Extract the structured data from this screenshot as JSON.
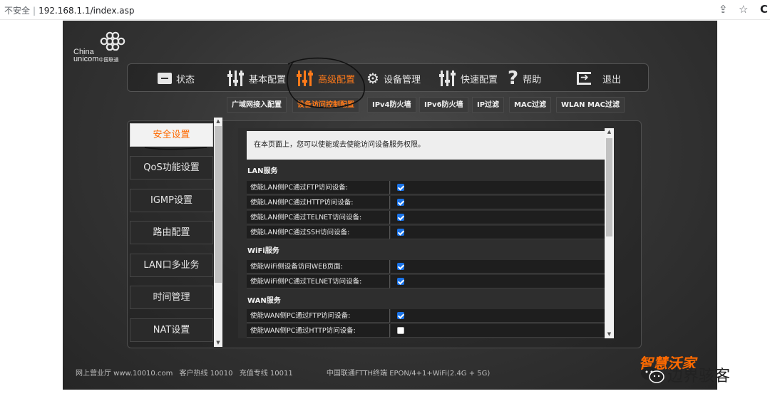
{
  "browser": {
    "insecure_label": "不安全",
    "separator": "|",
    "url": "192.168.1.1/index.asp"
  },
  "logo": {
    "line1": "China",
    "line2": "unicom",
    "line2_cn": "中国联通"
  },
  "main_nav": [
    {
      "label": "状态",
      "icon": "monitor-icon"
    },
    {
      "label": "基本配置",
      "icon": "sliders-icon"
    },
    {
      "label": "高级配置",
      "icon": "sliders-icon",
      "active": true
    },
    {
      "label": "设备管理",
      "icon": "gears-icon"
    },
    {
      "label": "快速配置",
      "icon": "sliders-icon"
    },
    {
      "label": "帮助",
      "icon": "question-icon"
    },
    {
      "label": "退出",
      "icon": "exit-icon"
    }
  ],
  "sub_nav": [
    {
      "label": "广域网接入配置"
    },
    {
      "label": "设备访问控制配置",
      "active": true
    },
    {
      "label": "IPv4防火墙"
    },
    {
      "label": "IPv6防火墙"
    },
    {
      "label": "IP过滤"
    },
    {
      "label": "MAC过滤"
    },
    {
      "label": "WLAN MAC过滤"
    }
  ],
  "side_menu": [
    {
      "label": "安全设置",
      "active": true
    },
    {
      "label": "QoS功能设置"
    },
    {
      "label": "IGMP设置"
    },
    {
      "label": "路由配置"
    },
    {
      "label": "LAN口多业务"
    },
    {
      "label": "时间管理"
    },
    {
      "label": "NAT设置"
    }
  ],
  "intro": "在本页面上，您可以使能或去使能访问设备服务权限。",
  "sections": {
    "lan": {
      "title": "LAN服务",
      "rows": [
        {
          "label": "使能LAN侧PC通过FTP访问设备:",
          "checked": true
        },
        {
          "label": "使能LAN侧PC通过HTTP访问设备:",
          "checked": true
        },
        {
          "label": "使能LAN侧PC通过TELNET访问设备:",
          "checked": true
        },
        {
          "label": "使能LAN侧PC通过SSH访问设备:",
          "checked": true
        }
      ]
    },
    "wifi": {
      "title": "WiFi服务",
      "rows": [
        {
          "label": "使能WiFi侧设备访问WEB页面:",
          "checked": true
        },
        {
          "label": "使能WiFi侧PC通过TELNET访问设备:",
          "checked": true
        }
      ]
    },
    "wan": {
      "title": "WAN服务",
      "rows": [
        {
          "label": "使能WAN侧PC通过FTP访问设备:",
          "checked": true
        },
        {
          "label": "使能WAN侧PC通过HTTP访问设备:",
          "checked": false
        }
      ]
    }
  },
  "footer": {
    "hall": "网上营业厅 www.10010.com",
    "hotline": "客户热线 10010",
    "charge": "充值专线 10011",
    "model": "中国联通FTTH终端 EPON/4+1+WiFi(2.4G + 5G)"
  },
  "watermarks": {
    "brand": "智慧沃家",
    "wechat": "边界骇客"
  },
  "colors": {
    "accent": "#ff7a1a",
    "checkbox": "#1a73e8",
    "annotation": "#111111"
  }
}
